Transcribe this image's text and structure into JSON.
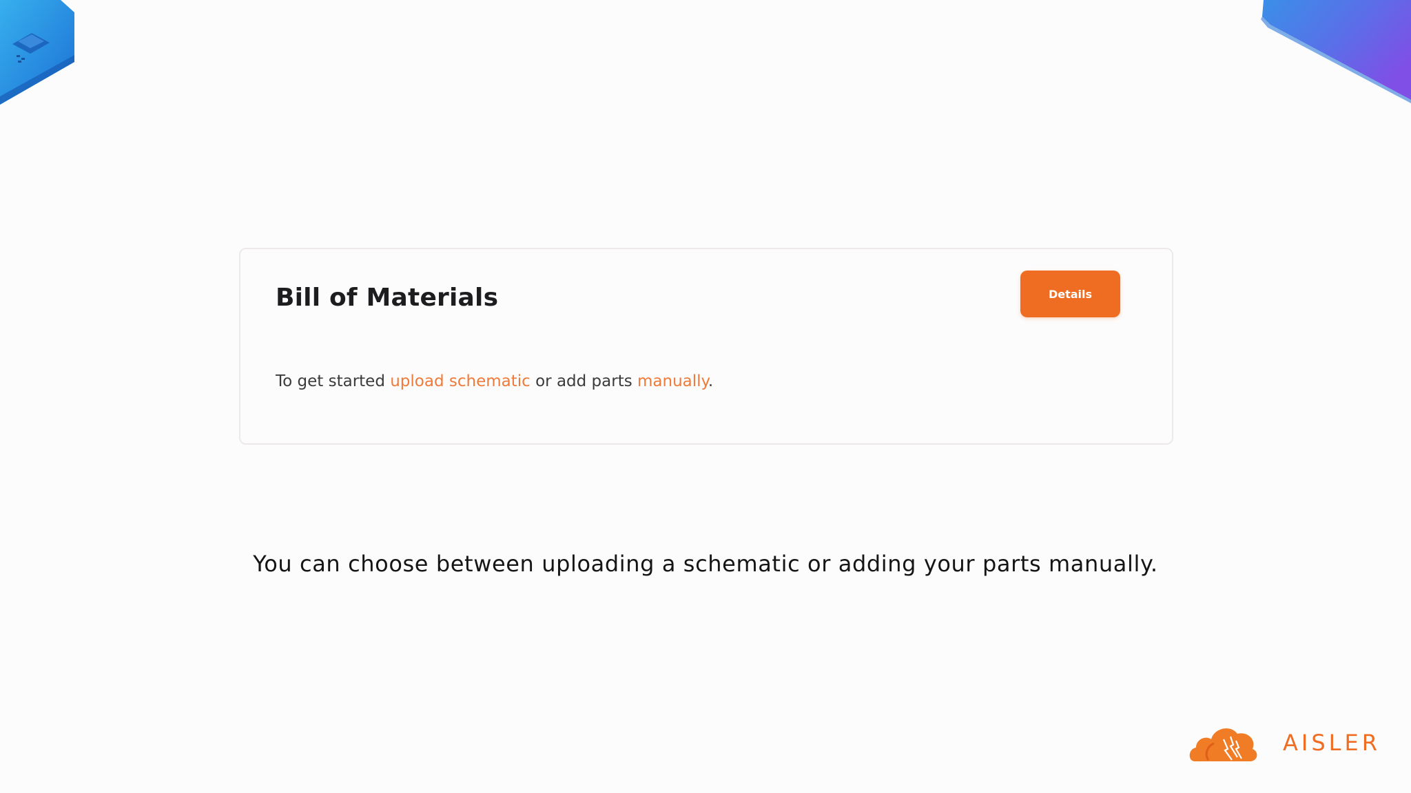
{
  "card": {
    "title": "Bill of Materials",
    "details_button": "Details",
    "intro_prefix": "To get started ",
    "upload_link": "upload schematic",
    "middle_text": " or add parts ",
    "manual_link": "manually",
    "suffix": "."
  },
  "caption": "You can choose between uploading a schematic or adding your parts manually.",
  "brand": {
    "name": "AISLER",
    "logo_icon": "cloud-logo-icon"
  },
  "decorations": {
    "left_icon": "circuit-board-icon",
    "right_icon": "abstract-shape-icon"
  },
  "colors": {
    "accent": "#ef6d22",
    "link": "#ef7a3a",
    "deco_blue_light": "#2fa6e6",
    "deco_blue_dark": "#1f6fcf",
    "deco_purple": "#7b4fe6"
  }
}
